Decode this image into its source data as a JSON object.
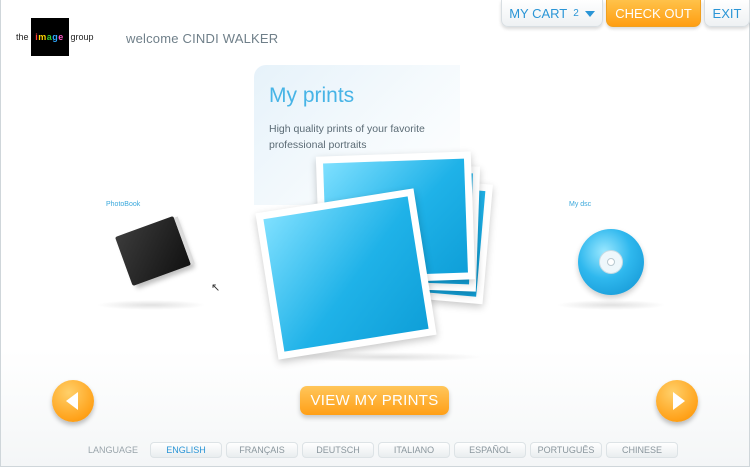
{
  "header": {
    "logo": {
      "pre": "the",
      "word": [
        "i",
        "m",
        "a",
        "g",
        "e"
      ],
      "post": "group"
    },
    "welcome": "welcome CINDI WALKER"
  },
  "topbar": {
    "cart_label": "MY CART",
    "cart_count": "2",
    "checkout_label": "CHECK OUT",
    "exit_label": "EXIT"
  },
  "hero": {
    "title": "My prints",
    "description": "High quality prints of your favorite professional portraits"
  },
  "side_items": {
    "left_label": "PhotoBook",
    "right_label": "My dsc"
  },
  "actions": {
    "view_label": "VIEW MY PRINTS"
  },
  "language": {
    "label": "LANGUAGE",
    "options": [
      "ENGLISH",
      "FRANÇAIS",
      "DEUTSCH",
      "ITALIANO",
      "ESPAÑOL",
      "PORTUGUÊS",
      "CHINESE"
    ],
    "selected": "ENGLISH"
  },
  "colors": {
    "accent_blue": "#2a95d6",
    "accent_orange": "#ff9e12"
  },
  "icons": {
    "cart_dropdown": "chevron-down-icon",
    "prev": "arrow-left-icon",
    "next": "arrow-right-icon",
    "disc": "disc-icon",
    "photobook": "photobook-icon",
    "cursor": "mouse-cursor-icon"
  }
}
